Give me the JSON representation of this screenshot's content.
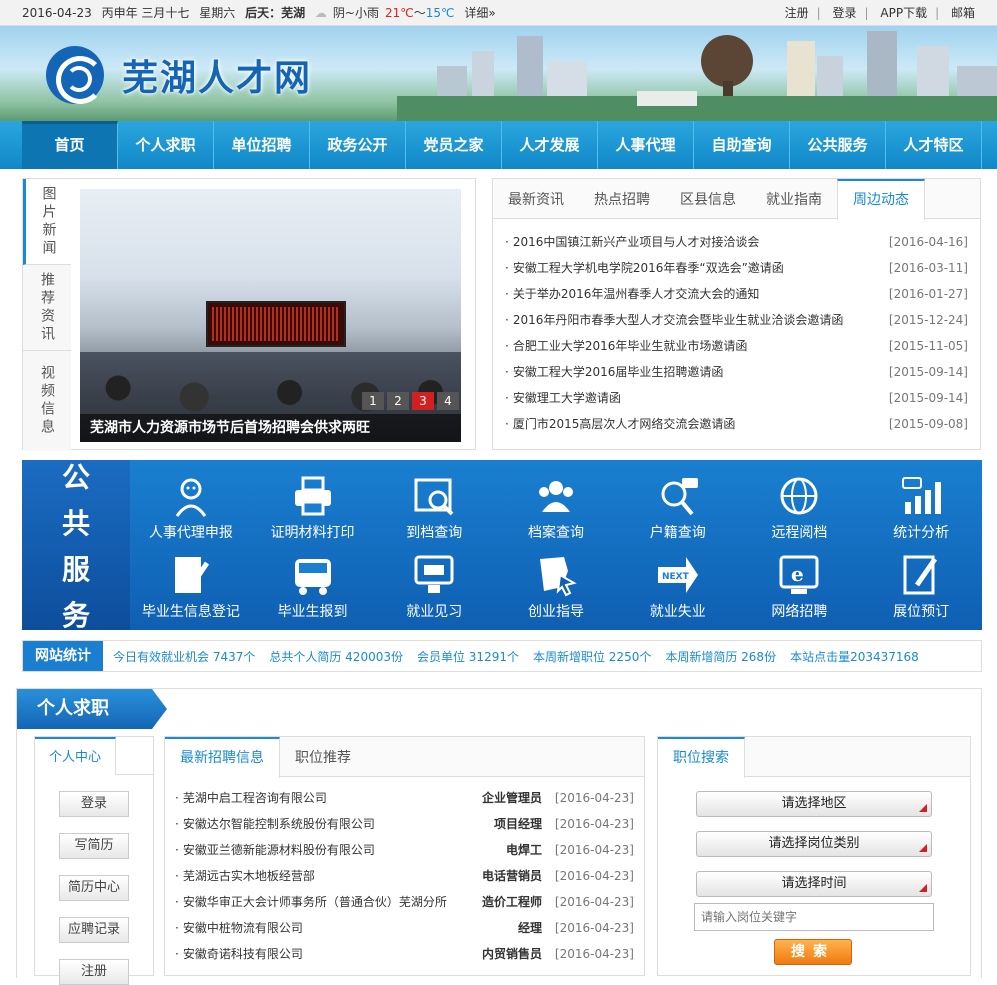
{
  "topbar": {
    "date": "2016-04-23",
    "lunar": "丙申年 三月十七",
    "weekday": "星期六",
    "day_label": "后天：芜湖",
    "weather": "阴~小雨",
    "temp_high": "21℃",
    "temp_sep": "～",
    "temp_low": "15℃",
    "detail": "详细»",
    "links": [
      "注册",
      "登录",
      "APP下载",
      "邮箱"
    ],
    "sep": "|"
  },
  "header": {
    "site_name": "芜湖人才网"
  },
  "nav": {
    "items": [
      "首页",
      "个人求职",
      "单位招聘",
      "政务公开",
      "党员之家",
      "人才发展",
      "人事代理",
      "自助查询",
      "公共服务",
      "人才特区"
    ]
  },
  "pic_news": {
    "vtabs": [
      "图片新闻",
      "推荐资讯",
      "视频信息"
    ],
    "caption": "芜湖市人力资源市场节后首场招聘会供求两旺",
    "pager": [
      "1",
      "2",
      "3",
      "4"
    ],
    "pager_active": "3"
  },
  "news": {
    "tabs": [
      "最新资讯",
      "热点招聘",
      "区县信息",
      "就业指南",
      "周边动态"
    ],
    "active_tab": "周边动态",
    "items": [
      {
        "title": "2016中国镇江新兴产业项目与人才对接洽谈会",
        "date": "[2016-04-16]"
      },
      {
        "title": "安徽工程大学机电学院2016年春季“双选会”邀请函",
        "date": "[2016-03-11]"
      },
      {
        "title": "关于举办2016年温州春季人才交流大会的通知",
        "date": "[2016-01-27]"
      },
      {
        "title": "2016年丹阳市春季大型人才交流会暨毕业生就业洽谈会邀请函",
        "date": "[2015-12-24]"
      },
      {
        "title": "合肥工业大学2016年毕业生就业市场邀请函",
        "date": "[2015-11-05]"
      },
      {
        "title": "安徽工程大学2016届毕业生招聘邀请函",
        "date": "[2015-09-14]"
      },
      {
        "title": "安徽理工大学邀请函",
        "date": "[2015-09-14]"
      },
      {
        "title": "厦门市2015高层次人才网络交流会邀请函",
        "date": "[2015-09-08]"
      }
    ]
  },
  "public_service": {
    "side_title": [
      "公",
      "共",
      "服",
      "务"
    ],
    "items": [
      {
        "label": "人事代理申报",
        "icon": "agent-icon"
      },
      {
        "label": "证明材料打印",
        "icon": "printer-icon"
      },
      {
        "label": "到档查询",
        "icon": "file-search-icon"
      },
      {
        "label": "档案查询",
        "icon": "people-icon"
      },
      {
        "label": "户籍查询",
        "icon": "chat-search-icon"
      },
      {
        "label": "远程阅档",
        "icon": "globe-icon"
      },
      {
        "label": "统计分析",
        "icon": "chart-icon"
      },
      {
        "label": "毕业生信息登记",
        "icon": "edit-doc-icon"
      },
      {
        "label": "毕业生报到",
        "icon": "bus-icon"
      },
      {
        "label": "就业见习",
        "icon": "monitor-icon"
      },
      {
        "label": "创业指导",
        "icon": "map-cursor-icon"
      },
      {
        "label": "就业失业",
        "icon": "next-sign-icon"
      },
      {
        "label": "网络招聘",
        "icon": "ie-icon"
      },
      {
        "label": "展位预订",
        "icon": "pen-doc-icon"
      }
    ]
  },
  "stats": {
    "label": "网站统计",
    "items": [
      "今日有效就业机会 7437个",
      "总共个人简历 420003份",
      "会员单位 31291个",
      "本周新增职位 2250个",
      "本周新增简历 268份",
      "本站点击量203437168"
    ]
  },
  "personal": {
    "banner": "个人求职",
    "center_title": "个人中心",
    "center_buttons": [
      "登录",
      "写简历",
      "简历中心",
      "应聘记录",
      "注册"
    ],
    "rec_tabs": [
      "最新招聘信息",
      "职位推荐"
    ],
    "rec_active": "最新招聘信息",
    "jobs": [
      {
        "company": "芜湖中启工程咨询有限公司",
        "position": "企业管理员",
        "date": "[2016-04-23]"
      },
      {
        "company": "安徽达尔智能控制系统股份有限公司",
        "position": "项目经理",
        "date": "[2016-04-23]"
      },
      {
        "company": "安徽亚兰德新能源材料股份有限公司",
        "position": "电焊工",
        "date": "[2016-04-23]"
      },
      {
        "company": "芜湖远古实木地板经营部",
        "position": "电话营销员",
        "date": "[2016-04-23]"
      },
      {
        "company": "安徽华审正大会计师事务所（普通合伙）芜湖分所",
        "position": "造价工程师",
        "date": "[2016-04-23]"
      },
      {
        "company": "安徽中桩物流有限公司",
        "position": "经理",
        "date": "[2016-04-23]"
      },
      {
        "company": "安徽奇诺科技有限公司",
        "position": "内贸销售员",
        "date": "[2016-04-23]"
      }
    ],
    "search_title": "职位搜索",
    "selects": [
      "请选择地区",
      "请选择岗位类别",
      "请选择时间"
    ],
    "keyword_placeholder": "请输入岗位关键字",
    "search_button": "搜索"
  }
}
